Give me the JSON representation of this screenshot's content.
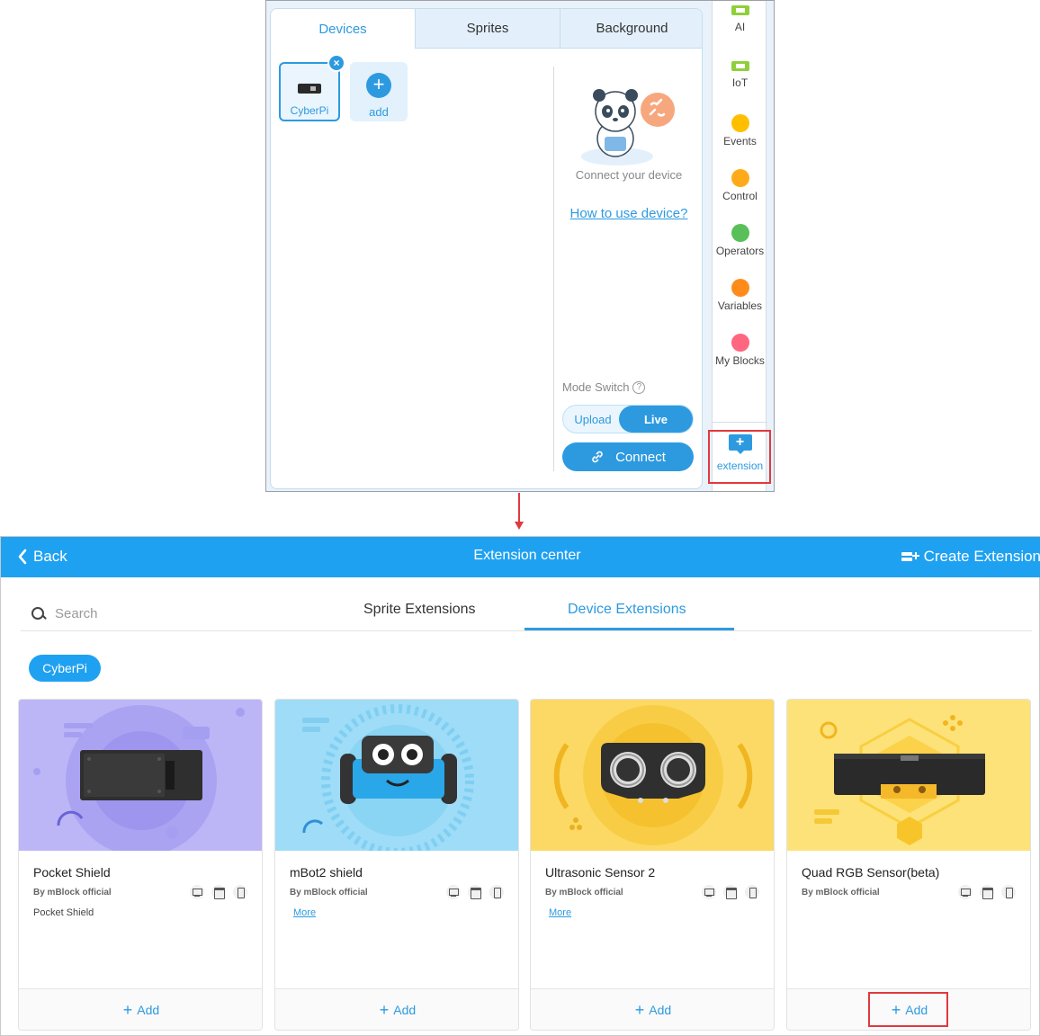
{
  "editor": {
    "tabs": [
      "Devices",
      "Sprites",
      "Background"
    ],
    "devices": [
      {
        "label": "CyberPi"
      }
    ],
    "add_label": "add",
    "connect_hint": "Connect your device",
    "howto_link": "How to use device?",
    "mode_switch_label": "Mode Switch",
    "mode_upload": "Upload",
    "mode_live": "Live",
    "connect_button": "Connect",
    "close_glyph": "×",
    "plus_glyph": "+"
  },
  "categories": [
    {
      "label": "AI",
      "icon": "ai-chip-icon",
      "color": "#8fcf3a"
    },
    {
      "label": "IoT",
      "icon": "iot-chip-icon",
      "color": "#8fcf3a"
    },
    {
      "label": "Events",
      "icon": "dot",
      "color": "#ffbf00"
    },
    {
      "label": "Control",
      "icon": "dot",
      "color": "#ffab19"
    },
    {
      "label": "Operators",
      "icon": "dot",
      "color": "#59c059"
    },
    {
      "label": "Variables",
      "icon": "dot",
      "color": "#ff8c1a"
    },
    {
      "label": "My Blocks",
      "icon": "dot",
      "color": "#ff6680"
    }
  ],
  "extension_button": "extension",
  "extension_center": {
    "back_label": "Back",
    "title": "Extension center",
    "create_label": "Create Extension",
    "search_placeholder": "Search",
    "tabs": [
      "Sprite Extensions",
      "Device Extensions"
    ],
    "active_tab": "Device Extensions",
    "filter_chip": "CyberPi",
    "cards": [
      {
        "name": "Pocket Shield",
        "author": "By mBlock official",
        "description": "Pocket Shield",
        "more": "",
        "add_label": "Add",
        "bg": "#bcb6f6"
      },
      {
        "name": "mBot2 shield",
        "author": "By mBlock official",
        "description": "",
        "more": "More",
        "add_label": "Add",
        "bg": "#9fdcf7"
      },
      {
        "name": "Ultrasonic Sensor 2",
        "author": "By mBlock official",
        "description": "",
        "more": "More",
        "add_label": "Add",
        "bg": "#fbd964"
      },
      {
        "name": "Quad RGB Sensor(beta)",
        "author": "By mBlock official",
        "description": "",
        "more": "",
        "add_label": "Add",
        "bg": "#fde27a"
      }
    ]
  },
  "colors": {
    "accent": "#2d9ae0",
    "header": "#1fa1f1",
    "highlight": "#e0393e"
  }
}
